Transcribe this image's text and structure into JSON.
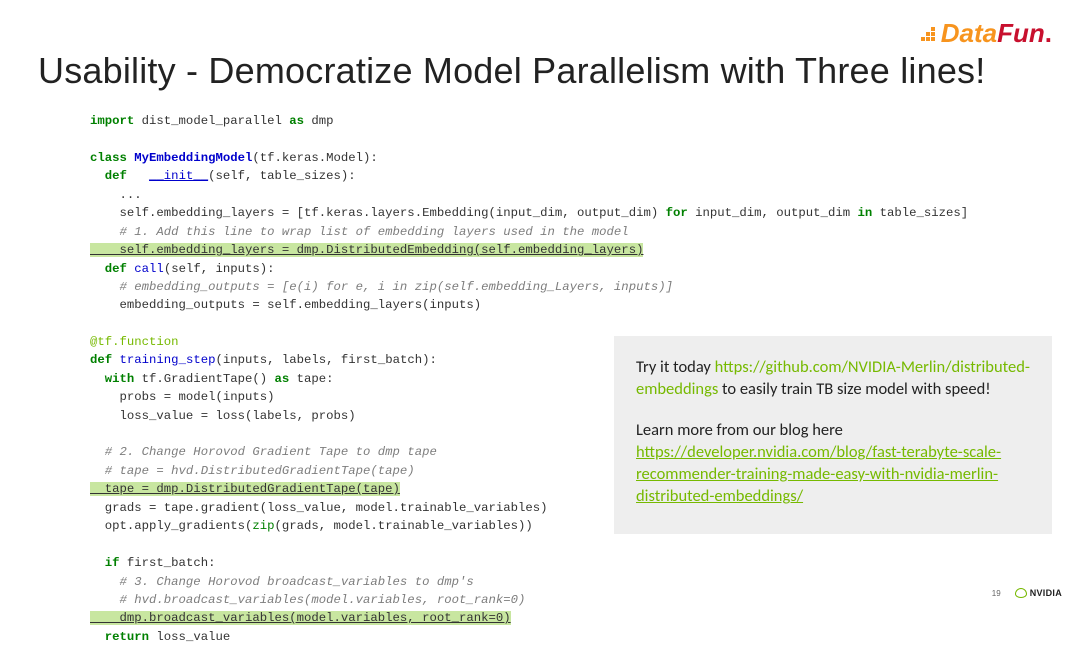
{
  "logo": {
    "part1": "Data",
    "part2": "Fun",
    "dot": "."
  },
  "title": "Usability - Democratize Model Parallelism with Three lines!",
  "code": {
    "l1_kw1": "import",
    "l1_mod": " dist_model_parallel ",
    "l1_kw2": "as",
    "l1_alias": " dmp",
    "l2_kw": "class ",
    "l2_cls": "MyEmbeddingModel",
    "l2_rest": "(tf.keras.Model):",
    "l3_kw": "  def   ",
    "l3_fn": "__init__",
    "l3_rest": "(self, table_sizes):",
    "l4": "    ...",
    "l5a": "    self.embedding_layers = [tf.keras.layers.Embedding(input_dim, output_dim) ",
    "l5_kw1": "for",
    "l5b": " input_dim, output_dim ",
    "l5_kw2": "in",
    "l5c": " table_sizes]",
    "l6": "    # 1. Add this line to wrap list of embedding layers used in the model",
    "l7": "    self.embedding_layers = dmp.DistributedEmbedding(self.embedding_layers)",
    "l8_kw": "  def ",
    "l8_fn": "call",
    "l8_rest": "(self, inputs):",
    "l9": "    # embedding_outputs = [e(i) for e, i in zip(self.embedding_Layers, inputs)]",
    "l10": "    embedding_outputs = self.embedding_layers(inputs)",
    "b1": "@tf.function",
    "b2_kw": "def ",
    "b2_fn": "training_step",
    "b2_rest": "(inputs, labels, first_batch):",
    "b3_kw": "  with ",
    "b3_a": "tf.GradientTape() ",
    "b3_kw2": "as",
    "b3_b": " tape:",
    "b4": "    probs = model(inputs)",
    "b5": "    loss_value = loss(labels, probs)",
    "b6": "  # 2. Change Horovod Gradient Tape to dmp tape",
    "b7": "  # tape = hvd.DistributedGradientTape(tape)",
    "b8": "  tape = dmp.DistributedGradientTape(tape)",
    "b9a": "  grads = tape.gradient(loss_value, model.trainable_variables)",
    "b10a": "  opt.apply_gradients(",
    "b10_zip": "zip",
    "b10b": "(grads, model.trainable_variables))",
    "b11_kw": "  if ",
    "b11_rest": "first_batch:",
    "b12": "    # 3. Change Horovod broadcast_variables to dmp's",
    "b13": "    # hvd.broadcast_variables(model.variables, root_rank=0)",
    "b14": "    dmp.broadcast_variables(model.variables, root_rank=0)",
    "b15_kw": "  return ",
    "b15_rest": "loss_value"
  },
  "info": {
    "p1_a": "Try it today ",
    "p1_link": "https://github.com/NVIDIA-Merlin/distributed-embeddings",
    "p1_b": " to easily train TB size model with speed!",
    "p2_a": "Learn more from our blog here ",
    "p2_link": "https://developer.nvidia.com/blog/fast-terabyte-scale-recommender-training-made-easy-with-nvidia-merlin-distributed-embeddings/"
  },
  "footer": {
    "page": "19",
    "brand": "NVIDIA"
  }
}
